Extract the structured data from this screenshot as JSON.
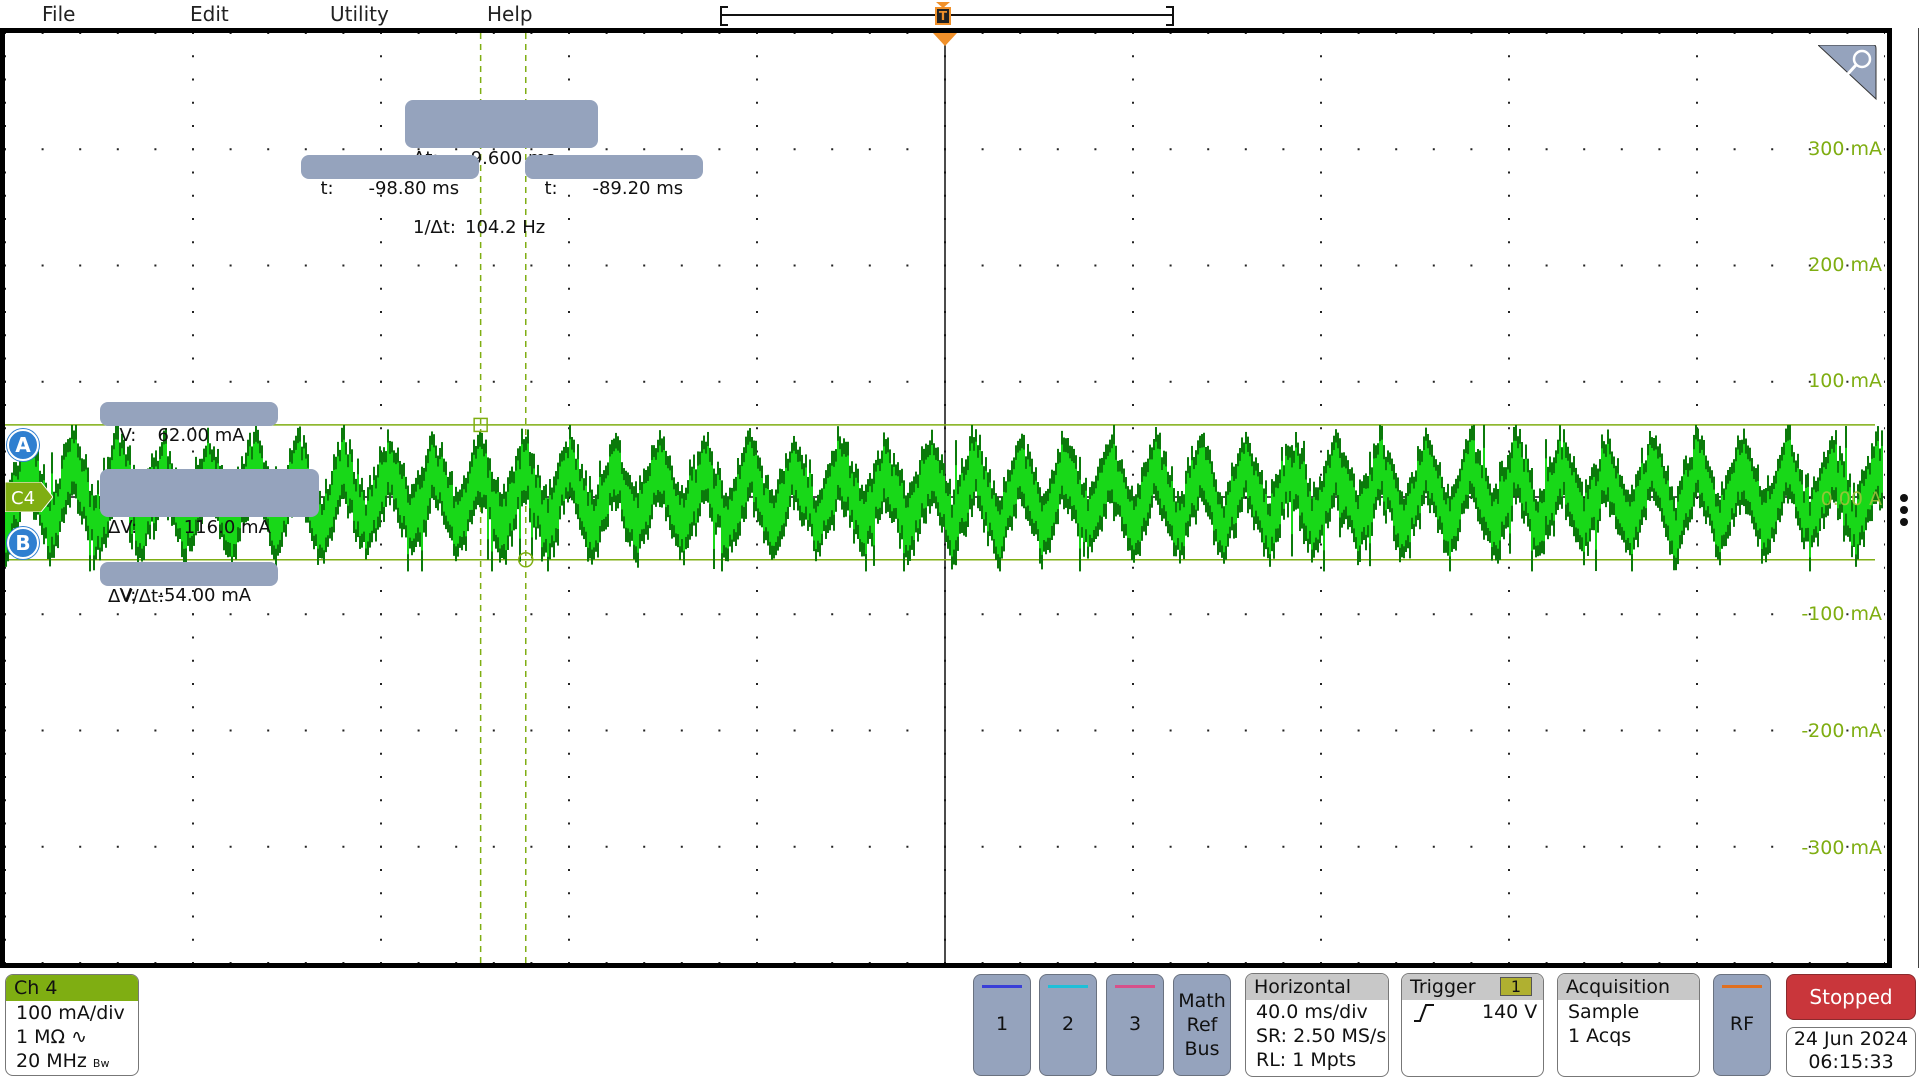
{
  "menu": {
    "items": [
      "File",
      "Edit",
      "Utility",
      "Help"
    ]
  },
  "colors": {
    "channel4": "#7fae12",
    "waveform": "#10d010",
    "cursor_badge": "#2f7fd0",
    "readout_bg": "#95a3bd",
    "trigger": "#f0902a",
    "stopped": "#c9363b",
    "ch1": "#3a3fd8",
    "ch2": "#1ec0d8",
    "ch3": "#d8508a",
    "rf": "#e07020"
  },
  "graticule": {
    "vertical_scale_labels": [
      "300 mA",
      "200 mA",
      "100 mA",
      "0.00 A",
      "-100 mA",
      "-200 mA",
      "-300 mA"
    ],
    "channel_marker": "C4",
    "cursor_a_label": "A",
    "cursor_b_label": "B",
    "zoom_icon": "magnifier-icon"
  },
  "cursors": {
    "delta_t_label": "Δt:",
    "delta_t_value": "9.600 ms",
    "inv_delta_t_label": "1/Δt:",
    "inv_delta_t_value": "104.2 Hz",
    "t1_label": "t:",
    "t1_value": "-98.80 ms",
    "t2_label": "t:",
    "t2_value": "-89.20 ms",
    "va_label": "V:",
    "va_value": "62.00 mA",
    "vb_label": "V:",
    "vb_value": "-54.00 mA",
    "delta_v_label": "ΔV:",
    "delta_v_value": "116.0 mA",
    "dv_dt_label": "ΔV/Δt:",
    "dv_dt_value": "",
    "v_a_ma": 62,
    "v_b_ma": -54,
    "t1_ms": -98.8,
    "t2_ms": -89.2
  },
  "waveform": {
    "channel": "Ch 4",
    "approx_frequency_hz": 104.2,
    "time_per_div_ms": 40,
    "ma_per_div": 100,
    "peak_ma": 62,
    "trough_ma": -54
  },
  "channel_badge": {
    "title": "Ch 4",
    "scale": "100 mA/div",
    "impedance": "1 MΩ ∿",
    "bandwidth": "20 MHz",
    "bw_suffix": "Bw"
  },
  "channel_buttons": [
    "1",
    "2",
    "3"
  ],
  "math_ref_bus": [
    "Math",
    "Ref",
    "Bus"
  ],
  "horizontal": {
    "title": "Horizontal",
    "scale": "40.0 ms/div",
    "sample_rate": "SR: 2.50 MS/s",
    "record_length": "RL: 1 Mpts"
  },
  "trigger": {
    "title": "Trigger",
    "source": "1",
    "slope_icon": "rising-edge-icon",
    "level": "140 V"
  },
  "acquisition": {
    "title": "Acquisition",
    "mode": "Sample",
    "count": "1 Acqs"
  },
  "rf_button": "RF",
  "run_state": "Stopped",
  "date": "24 Jun 2024",
  "time": "06:15:33"
}
